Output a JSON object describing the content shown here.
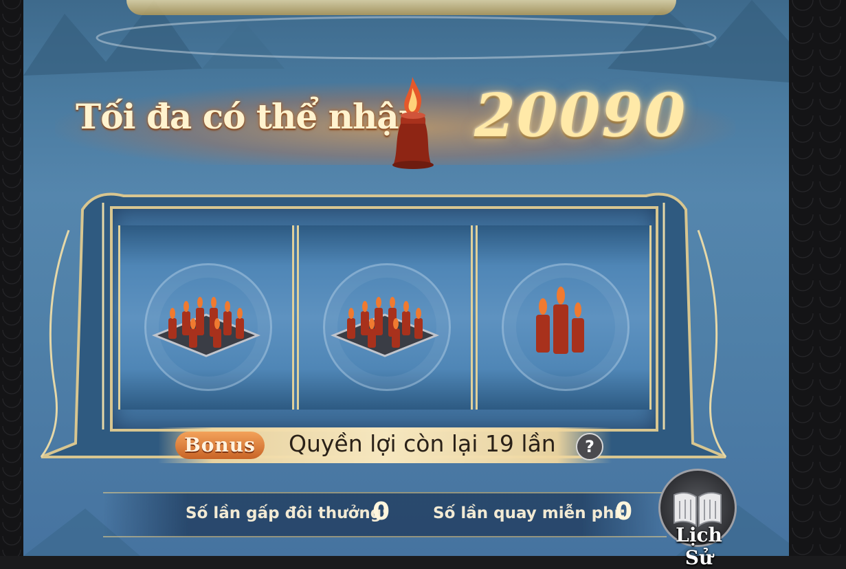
{
  "header": {
    "title": "Tối đa có thể nhận",
    "max_value": "20090",
    "currency_icon": "candle-icon"
  },
  "reels": [
    {
      "icon": "candle-tray-large-icon"
    },
    {
      "icon": "candle-tray-large-icon"
    },
    {
      "icon": "candle-cluster-icon"
    }
  ],
  "bonus": {
    "tag": "Bonus",
    "text": "Quyền lợi còn lại 19 lần",
    "help_icon": "?"
  },
  "stats": {
    "double_label": "Số lần gấp đôi thưởng:",
    "double_value": "0",
    "free_spin_label": "Số lần quay miễn phí:",
    "free_spin_value": "0"
  },
  "history": {
    "label": "Lịch Sử"
  },
  "colors": {
    "gold": "#e0d09a",
    "scene_blue": "#4a7ba0",
    "bonus_orange": "#c86426"
  }
}
